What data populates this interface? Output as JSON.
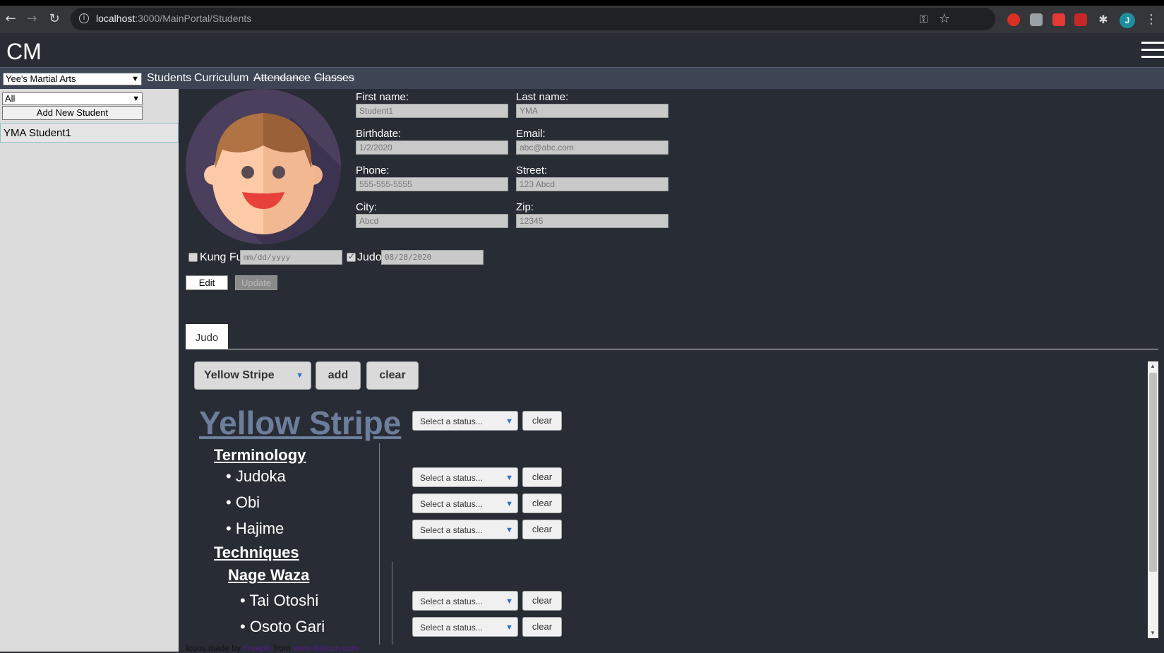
{
  "browser": {
    "url_host": "localhost",
    "url_path": ":3000/MainPortal/Students",
    "profile_initial": "J"
  },
  "app": {
    "brand": "CM",
    "school": "Yee's Martial Arts",
    "nav": [
      {
        "label": "Students",
        "strikethrough": false
      },
      {
        "label": "Curriculum",
        "strikethrough": false
      },
      {
        "label": "Attendance",
        "strikethrough": true
      },
      {
        "label": "Classes",
        "strikethrough": true
      }
    ]
  },
  "sidebar": {
    "filter_value": "All",
    "add_label": "Add New Student",
    "students": [
      "YMA Student1"
    ]
  },
  "profile": {
    "first_name_label": "First name:",
    "first_name": "Student1",
    "last_name_label": "Last name:",
    "last_name": "YMA",
    "birthdate_label": "Birthdate:",
    "birthdate": "1/2/2020",
    "email_label": "Email:",
    "email": "abc@abc.com",
    "phone_label": "Phone:",
    "phone": "555-555-5555",
    "street_label": "Street:",
    "street": "123 Abcd",
    "city_label": "City:",
    "city": "Abcd",
    "zip_label": "Zip:",
    "zip": "12345",
    "programs": [
      {
        "label": "Kung Fu",
        "checked": false,
        "date": "mm/dd/yyyy"
      },
      {
        "label": "Judo",
        "checked": true,
        "date": "08/28/2020"
      }
    ],
    "edit_label": "Edit",
    "update_label": "Update"
  },
  "curriculum": {
    "tab": "Judo",
    "rank_selected": "Yellow Stripe",
    "add_label": "add",
    "clear_label": "clear",
    "rank_title": "Yellow Stripe",
    "status_placeholder": "Select a status...",
    "item_clear": "clear",
    "terminology_title": "Terminology",
    "terminology": [
      "Judoka",
      "Obi",
      "Hajime"
    ],
    "techniques_title": "Techniques",
    "nage_waza_title": "Nage Waza",
    "nage_waza": [
      "Tai Otoshi",
      "Osoto Gari"
    ]
  },
  "footer": {
    "credit_prefix": "Icons made by ",
    "author": "Freepik",
    "from": " from ",
    "site": "www.flaticon.com"
  },
  "colors": {
    "background": "#282c34",
    "rank_title": "#6d7e9c",
    "sidebar": "#dcdcdc",
    "select_caret": "#2a6fc9"
  }
}
